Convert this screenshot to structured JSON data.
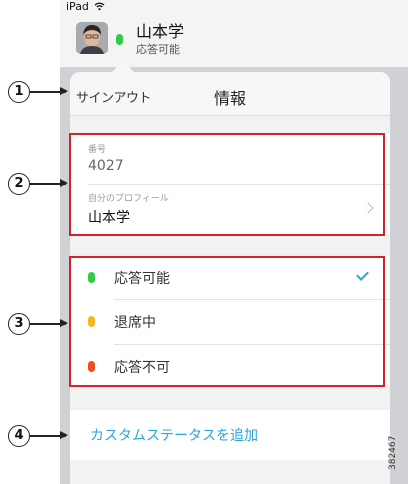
{
  "status_bar": {
    "device": "iPad"
  },
  "header": {
    "user_name": "山本学",
    "user_status": "応答可能",
    "presence_color": "#35c94a"
  },
  "popover": {
    "sign_out_label": "サインアウト",
    "title": "情報",
    "number_label": "番号",
    "number_value": "4027",
    "profile_label": "自分のプロフィール",
    "profile_value": "山本学"
  },
  "statuses": [
    {
      "label": "応答可能",
      "color": "#35c94a",
      "selected": true
    },
    {
      "label": "退席中",
      "color": "#f4b81c",
      "selected": false
    },
    {
      "label": "応答不可",
      "color": "#f04d1c",
      "selected": false
    }
  ],
  "add_custom_status_label": "カスタムステータスを追加",
  "callouts": [
    "1",
    "2",
    "3",
    "4"
  ],
  "figure_id": "382467",
  "colors": {
    "accent": "#2aa6d8",
    "callout_frame": "#d2232a"
  }
}
